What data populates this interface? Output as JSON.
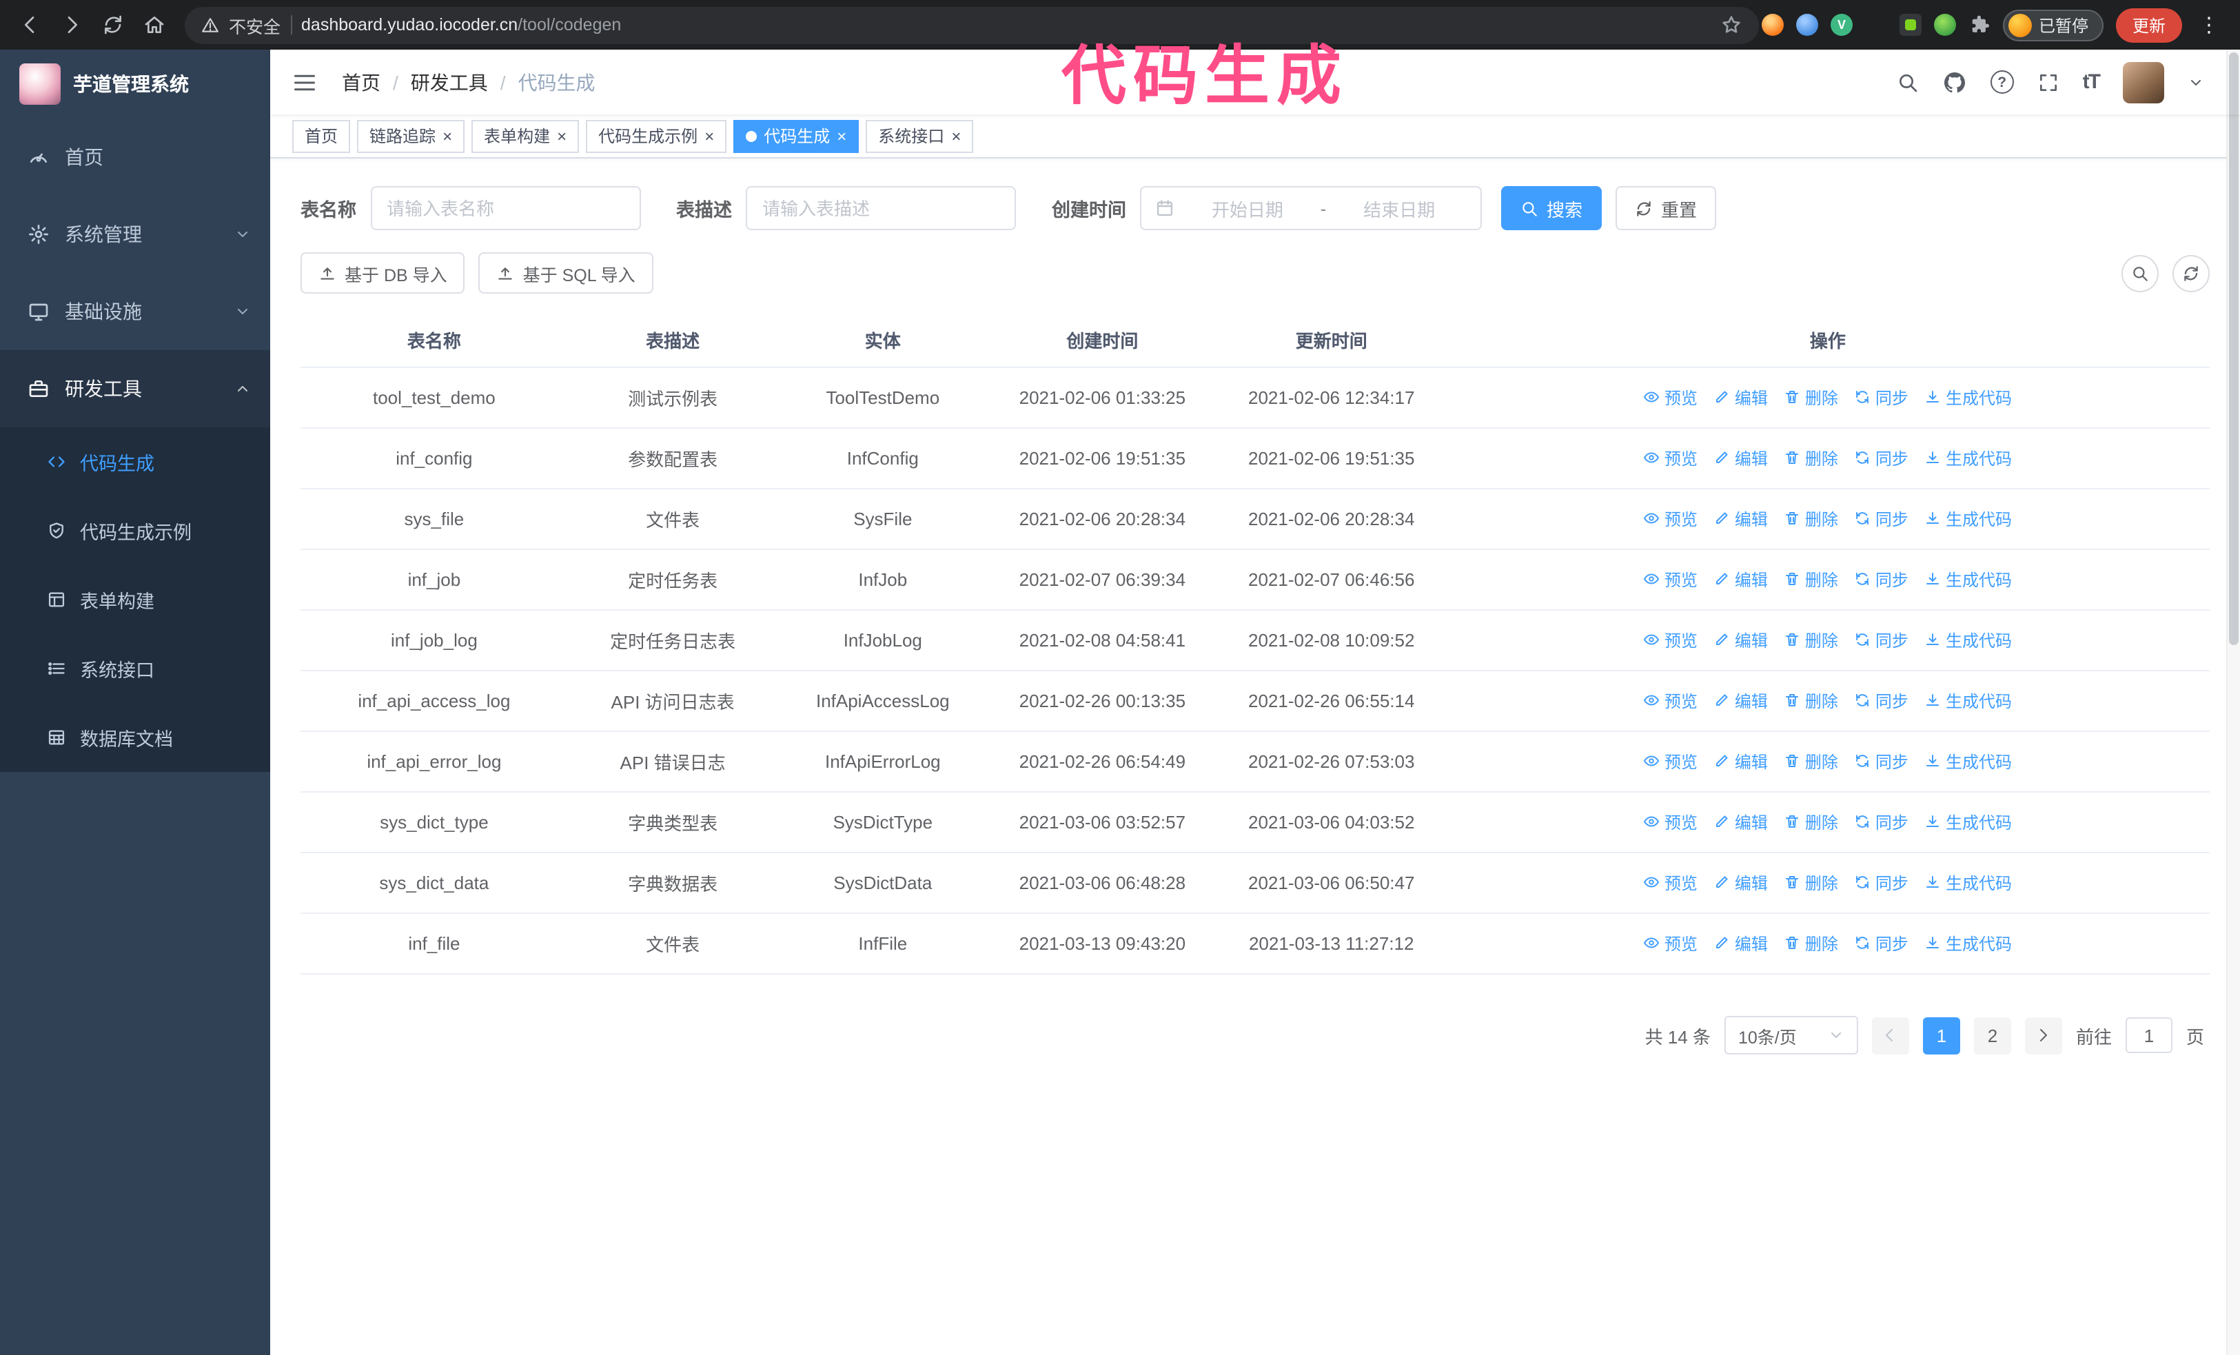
{
  "annotation": {
    "text": "代码生成"
  },
  "browser": {
    "security_label": "不安全",
    "url_host": "dashboard.yudao.iocoder.cn",
    "url_path": "/tool/codegen",
    "paused_badge": "已暂停",
    "update_button": "更新"
  },
  "glyphs": {
    "close": "×",
    "kebab": "⋮",
    "question": "?",
    "font_size": "tT",
    "vue_letter": "V"
  },
  "sidebar": {
    "title": "芋道管理系统",
    "items": [
      {
        "label": "首页"
      },
      {
        "label": "系统管理"
      },
      {
        "label": "基础设施"
      },
      {
        "label": "研发工具"
      }
    ],
    "subitems": [
      {
        "label": "代码生成"
      },
      {
        "label": "代码生成示例"
      },
      {
        "label": "表单构建"
      },
      {
        "label": "系统接口"
      },
      {
        "label": "数据库文档"
      }
    ]
  },
  "breadcrumb": {
    "items": [
      "首页",
      "研发工具",
      "代码生成"
    ],
    "separator": "/"
  },
  "tabs": [
    {
      "label": "首页"
    },
    {
      "label": "链路追踪"
    },
    {
      "label": "表单构建"
    },
    {
      "label": "代码生成示例"
    },
    {
      "label": "代码生成"
    },
    {
      "label": "系统接口"
    }
  ],
  "filters": {
    "table_name": {
      "label": "表名称",
      "placeholder": "请输入表名称"
    },
    "table_desc": {
      "label": "表描述",
      "placeholder": "请输入表描述"
    },
    "create_time": {
      "label": "创建时间",
      "start_placeholder": "开始日期",
      "separator": "-",
      "end_placeholder": "结束日期"
    },
    "search_button": "搜索",
    "reset_button": "重置"
  },
  "toolbar": {
    "import_db_button": "基于 DB 导入",
    "import_sql_button": "基于 SQL 导入"
  },
  "table": {
    "columns": [
      "表名称",
      "表描述",
      "实体",
      "创建时间",
      "更新时间",
      "操作"
    ],
    "actions": [
      {
        "key": "preview",
        "label": "预览"
      },
      {
        "key": "edit",
        "label": "编辑"
      },
      {
        "key": "delete",
        "label": "删除"
      },
      {
        "key": "sync",
        "label": "同步"
      },
      {
        "key": "generate",
        "label": "生成代码"
      }
    ],
    "rows": [
      {
        "name": "tool_test_demo",
        "desc": "测试示例表",
        "entity": "ToolTestDemo",
        "created": "2021-02-06 01:33:25",
        "updated": "2021-02-06 12:34:17"
      },
      {
        "name": "inf_config",
        "desc": "参数配置表",
        "entity": "InfConfig",
        "created": "2021-02-06 19:51:35",
        "updated": "2021-02-06 19:51:35"
      },
      {
        "name": "sys_file",
        "desc": "文件表",
        "entity": "SysFile",
        "created": "2021-02-06 20:28:34",
        "updated": "2021-02-06 20:28:34"
      },
      {
        "name": "inf_job",
        "desc": "定时任务表",
        "entity": "InfJob",
        "created": "2021-02-07 06:39:34",
        "updated": "2021-02-07 06:46:56"
      },
      {
        "name": "inf_job_log",
        "desc": "定时任务日志表",
        "entity": "InfJobLog",
        "created": "2021-02-08 04:58:41",
        "updated": "2021-02-08 10:09:52"
      },
      {
        "name": "inf_api_access_log",
        "desc": "API 访问日志表",
        "entity": "InfApiAccessLog",
        "created": "2021-02-26 00:13:35",
        "updated": "2021-02-26 06:55:14"
      },
      {
        "name": "inf_api_error_log",
        "desc": "API 错误日志",
        "entity": "InfApiErrorLog",
        "created": "2021-02-26 06:54:49",
        "updated": "2021-02-26 07:53:03"
      },
      {
        "name": "sys_dict_type",
        "desc": "字典类型表",
        "entity": "SysDictType",
        "created": "2021-03-06 03:52:57",
        "updated": "2021-03-06 04:03:52"
      },
      {
        "name": "sys_dict_data",
        "desc": "字典数据表",
        "entity": "SysDictData",
        "created": "2021-03-06 06:48:28",
        "updated": "2021-03-06 06:50:47"
      },
      {
        "name": "inf_file",
        "desc": "文件表",
        "entity": "InfFile",
        "created": "2021-03-13 09:43:20",
        "updated": "2021-03-13 11:27:12"
      }
    ]
  },
  "pagination": {
    "total": "共 14 条",
    "page_size": "10条/页",
    "pages": [
      "1",
      "2"
    ],
    "goto_label": "前往",
    "goto_value": "1",
    "goto_suffix": "页"
  }
}
